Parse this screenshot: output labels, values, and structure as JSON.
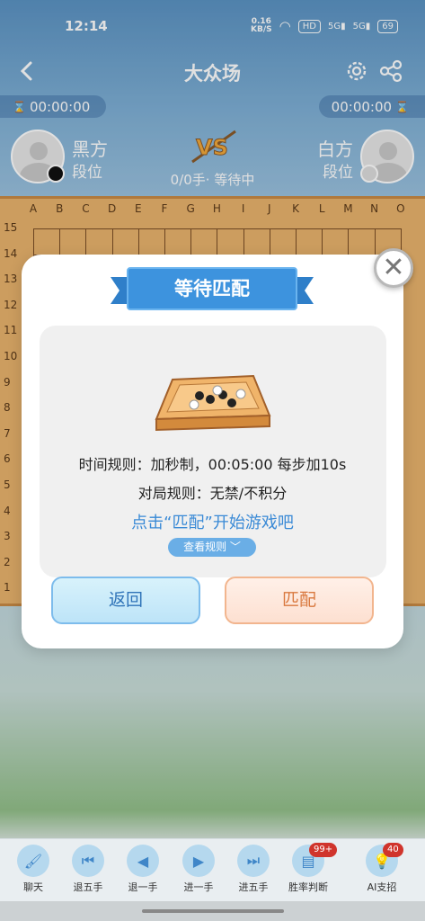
{
  "status_bar": {
    "time": "12:14",
    "speed_top": "0.16",
    "speed_unit": "KB/S",
    "hd": "HD",
    "net1": "5G",
    "net2": "5G",
    "battery": "69"
  },
  "header": {
    "title": "大众场"
  },
  "timers": {
    "left": "00:00:00",
    "right": "00:00:00"
  },
  "players": {
    "black": {
      "name": "黑方",
      "rank": "段位"
    },
    "white": {
      "name": "白方",
      "rank": "段位"
    }
  },
  "move_status": "0/0手· 等待中",
  "board": {
    "columns": [
      "A",
      "B",
      "C",
      "D",
      "E",
      "F",
      "G",
      "H",
      "I",
      "J",
      "K",
      "L",
      "M",
      "N",
      "O"
    ],
    "rows": [
      "15",
      "14",
      "13",
      "12",
      "11",
      "10",
      "9",
      "8",
      "7",
      "6",
      "5",
      "4",
      "3",
      "2",
      "1"
    ]
  },
  "modal": {
    "title": "等待匹配",
    "time_rule": "时间规则：加秒制，00:05:00 每步加10s",
    "game_rule": "对局规则：无禁/不积分",
    "hint": "点击“匹配”开始游戏吧",
    "view_rules": "查看规则",
    "back_label": "返回",
    "match_label": "匹配",
    "close_symbol": "✕"
  },
  "toolbar": [
    {
      "label": "聊天",
      "icon": "brush-icon"
    },
    {
      "label": "退五手",
      "icon": "skip-back-icon"
    },
    {
      "label": "退一手",
      "icon": "step-back-icon"
    },
    {
      "label": "进一手",
      "icon": "step-forward-icon"
    },
    {
      "label": "进五手",
      "icon": "skip-forward-icon"
    },
    {
      "label": "胜率判断",
      "icon": "win-rate-icon",
      "badge": "99+"
    },
    {
      "label": "AI支招",
      "icon": "lightbulb-icon",
      "badge": "40"
    }
  ],
  "colors": {
    "accent": "#3a8ad6",
    "board": "#e9b36d",
    "match": "#d9783e"
  }
}
